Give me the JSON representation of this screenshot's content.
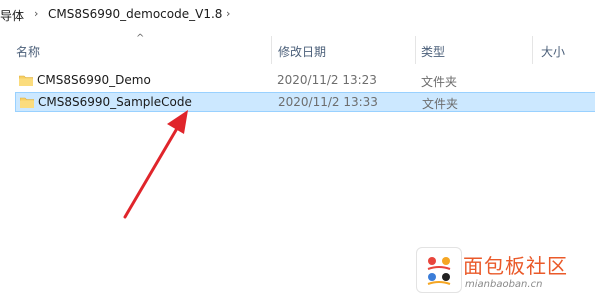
{
  "breadcrumb": {
    "items": [
      "导体",
      "CMS8S6990_democode_V1.8"
    ],
    "separator": "›",
    "dropdown": "⌄"
  },
  "columns": {
    "name": "名称",
    "modified": "修改日期",
    "type": "类型",
    "size": "大小",
    "sort_indicator": "^"
  },
  "files": [
    {
      "name": "CMS8S6990_Demo",
      "modified": "2020/11/2 13:23",
      "type": "文件夹",
      "selected": false,
      "icon": "folder-icon"
    },
    {
      "name": "CMS8S6990_SampleCode",
      "modified": "2020/11/2 13:33",
      "type": "文件夹",
      "selected": true,
      "icon": "folder-icon"
    }
  ],
  "annotation": {
    "color": "#e0252b",
    "shape": "arrow"
  },
  "watermark": {
    "title": "面包板社区",
    "subtitle": "mianbaoban.cn"
  },
  "colors": {
    "selection_fill": "#cce8ff",
    "selection_border": "#99d1ff",
    "folder": "#f7cf63"
  }
}
